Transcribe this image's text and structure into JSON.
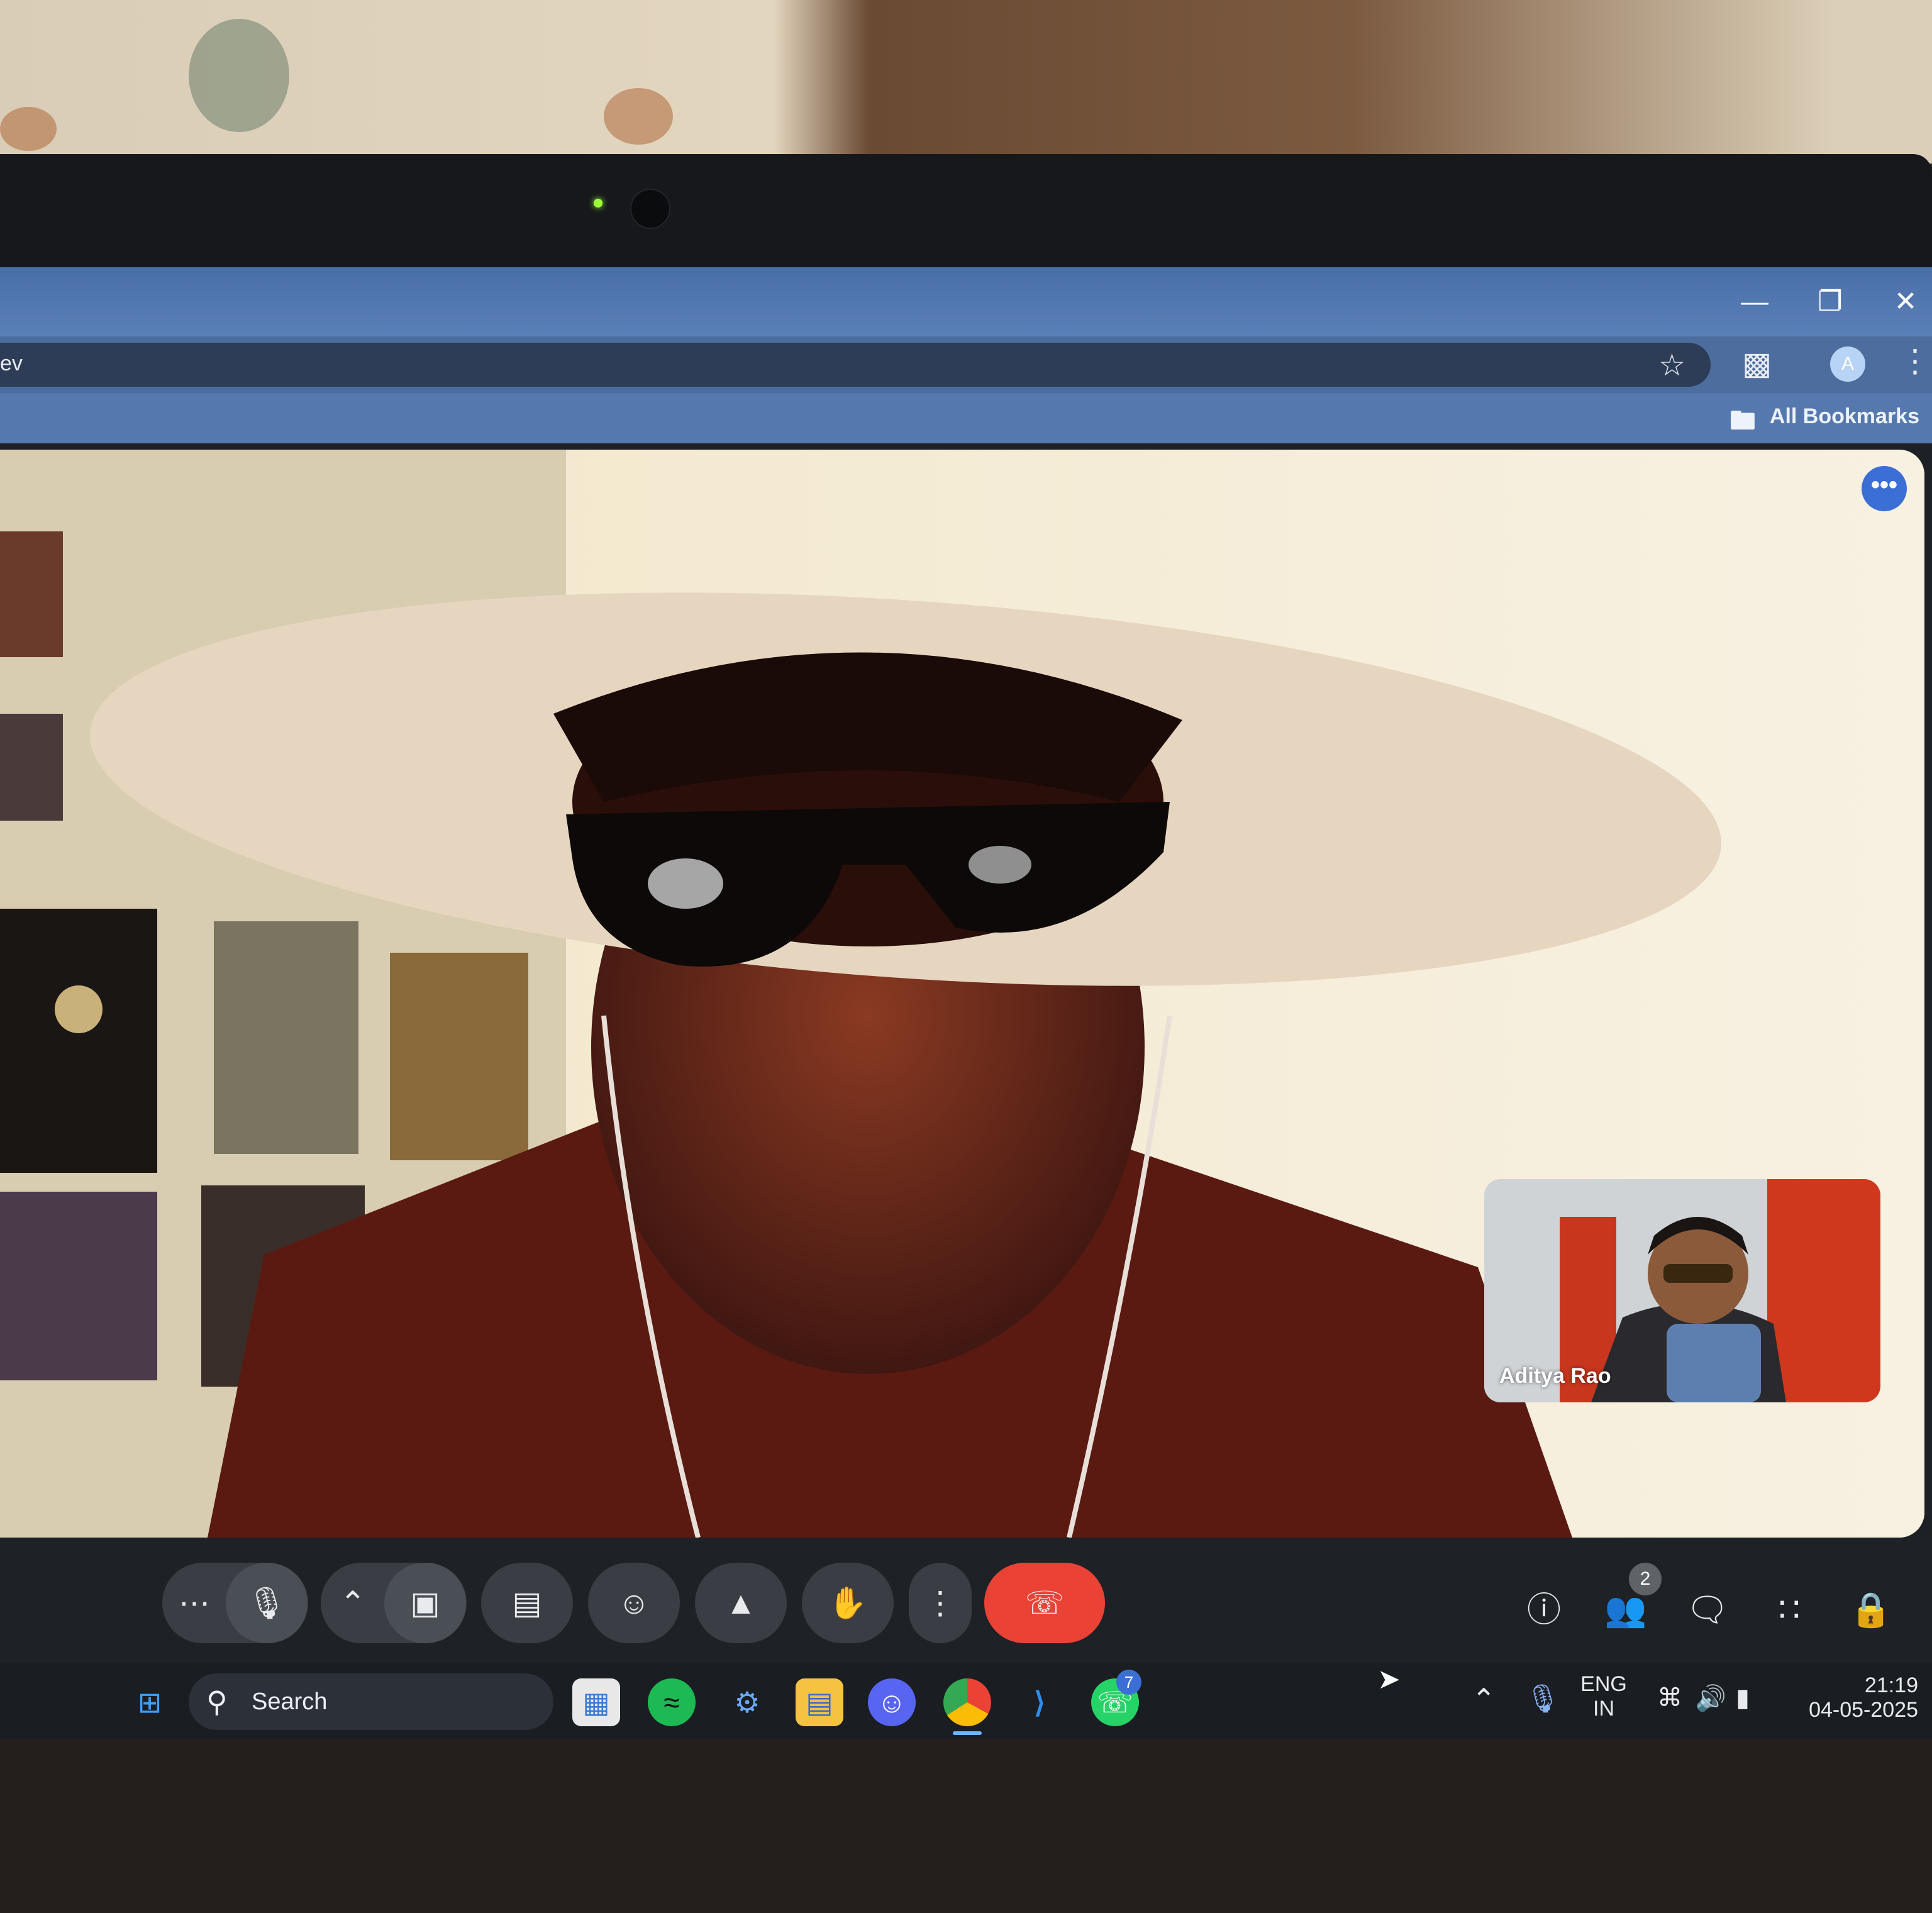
{
  "browser": {
    "omnibox_text": "ev",
    "bookmarks_label": "All Bookmarks",
    "window_controls": [
      "minimize-icon",
      "restore-icon",
      "close-icon"
    ],
    "profile_initial": "A"
  },
  "meet": {
    "self_tile_name": "Aditya Rao",
    "people_count": "2",
    "more_options_label": "•••",
    "controls": [
      "more-icon",
      "mic-icon",
      "chevron-up-icon",
      "camera-icon",
      "captions-icon",
      "emoji-icon",
      "present-icon",
      "raise-hand-icon",
      "more-vert-icon",
      "end-call-icon"
    ],
    "right_controls": [
      "info-icon",
      "people-icon",
      "chat-icon",
      "apps-icon",
      "host-controls-icon"
    ],
    "colors": {
      "end_call": "#ea4335",
      "accent": "#3c6fd6"
    }
  },
  "taskbar": {
    "search_placeholder": "Search",
    "language_line1": "ENG",
    "language_line2": "IN",
    "time": "21:19",
    "date": "04-05-2025",
    "whatsapp_badge": "7",
    "apps": [
      "start-icon",
      "store-icon",
      "spotify-icon",
      "settings-icon",
      "file-explorer-icon",
      "discord-icon",
      "chrome-icon",
      "vscode-icon",
      "whatsapp-icon"
    ]
  }
}
